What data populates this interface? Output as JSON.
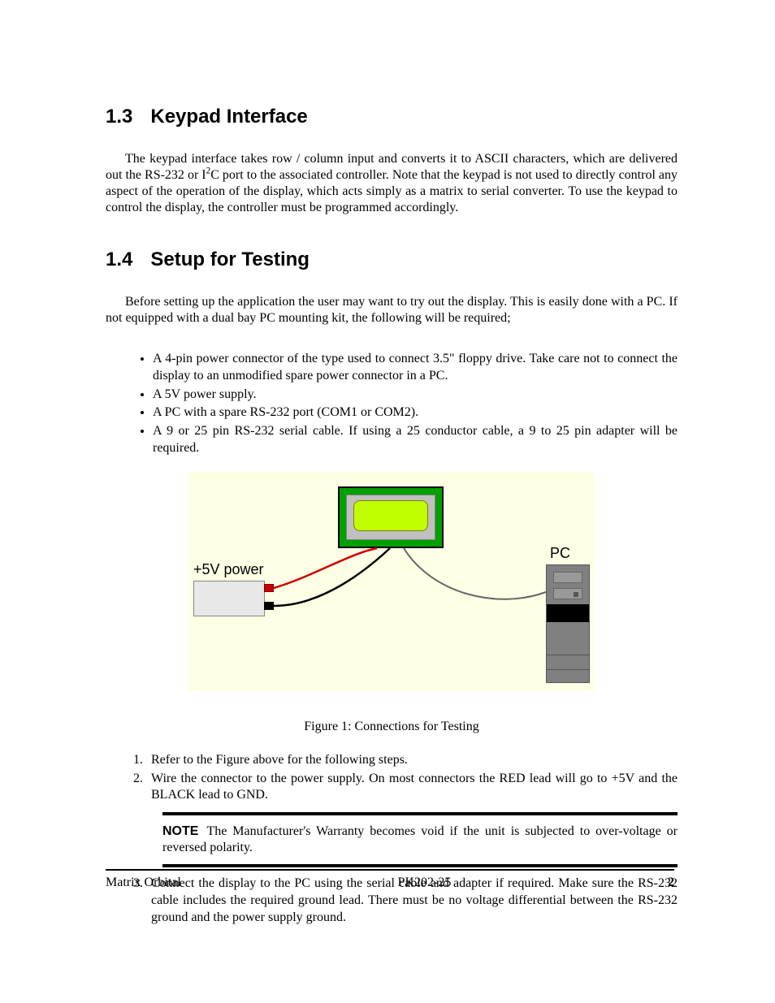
{
  "section1": {
    "num": "1.3",
    "title": "Keypad Interface"
  },
  "para1": "The keypad interface takes row / column input and converts it to ASCII characters, which are delivered out the RS-232 or I",
  "para1_sup": "2",
  "para1_b": "C port to the associated controller. Note that the keypad is not used to directly control any aspect of the operation of the display, which acts simply as a matrix to serial converter. To use the keypad to control the display, the controller must be programmed accordingly.",
  "section2": {
    "num": "1.4",
    "title": "Setup for Testing"
  },
  "para2": "Before setting up the application the user may want to try out the display. This is easily done with a PC. If not equipped with a dual bay PC mounting kit, the following will be required;",
  "bullets": [
    "A 4-pin power connector of the type used to connect 3.5\" floppy drive. Take care not to connect the display to an unmodified spare power connector in a PC.",
    "A 5V power supply.",
    "A PC with a spare RS-232 port (COM1 or COM2).",
    "A 9 or 25 pin RS-232 serial cable. If using a 25 conductor cable, a 9 to 25 pin adapter will be required."
  ],
  "figure": {
    "power_label": "+5V power",
    "pc_label": "PC",
    "caption": "Figure 1: Connections for Testing"
  },
  "steps": {
    "s1": "Refer to the Figure above for the following steps.",
    "s2": "Wire the connector to the power supply. On most connectors the RED lead will go to +5V and the BLACK lead to GND.",
    "s3": "Connect the display to the PC using the serial cable and adapter if required. Make sure the RS-232 cable includes the required ground lead. There must be no voltage differential between the RS-232 ground and the power supply ground."
  },
  "note": {
    "label": "NOTE",
    "text": "The Manufacturer's Warranty becomes void if the unit is subjected to over-voltage or reversed polarity."
  },
  "footer": {
    "left": "Matrix Orbital",
    "center": "PK202-25",
    "right": "2"
  }
}
